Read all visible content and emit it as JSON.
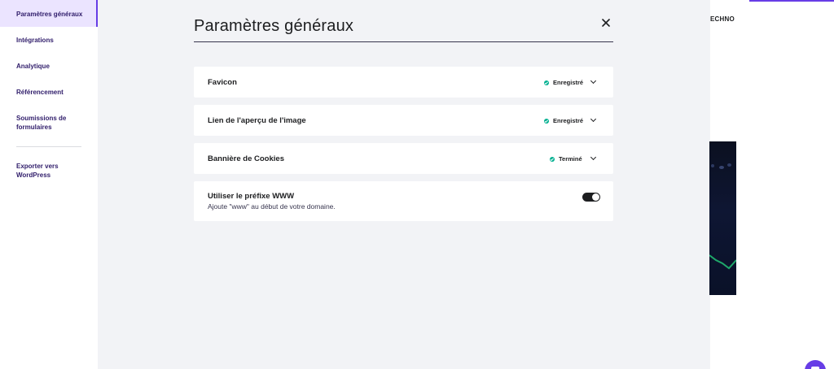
{
  "sidebar": {
    "items": [
      {
        "label": "Paramètres généraux",
        "active": true
      },
      {
        "label": "Intégrations"
      },
      {
        "label": "Analytique"
      },
      {
        "label": "Référencement"
      },
      {
        "label": "Soumissions de formulaires"
      },
      {
        "label": "Exporter vers WordPress"
      }
    ]
  },
  "main": {
    "title": "Paramètres généraux",
    "close_icon": "close-icon",
    "cards": [
      {
        "label": "Favicon",
        "status": "Enregistré"
      },
      {
        "label": "Lien de l'aperçu de l'image",
        "status": "Enregistré"
      },
      {
        "label": "Bannière de Cookies",
        "status": "Terminé"
      }
    ],
    "www_prefix": {
      "label": "Utiliser le préfixe WWW",
      "description": "Ajoute \"www\" au début de votre domaine.",
      "enabled": true
    }
  },
  "preview": {
    "brand": "ECHNO"
  },
  "colors": {
    "accent": "#673de6",
    "status_ok": "#00b090",
    "panel_bg": "#f2f3f6"
  }
}
